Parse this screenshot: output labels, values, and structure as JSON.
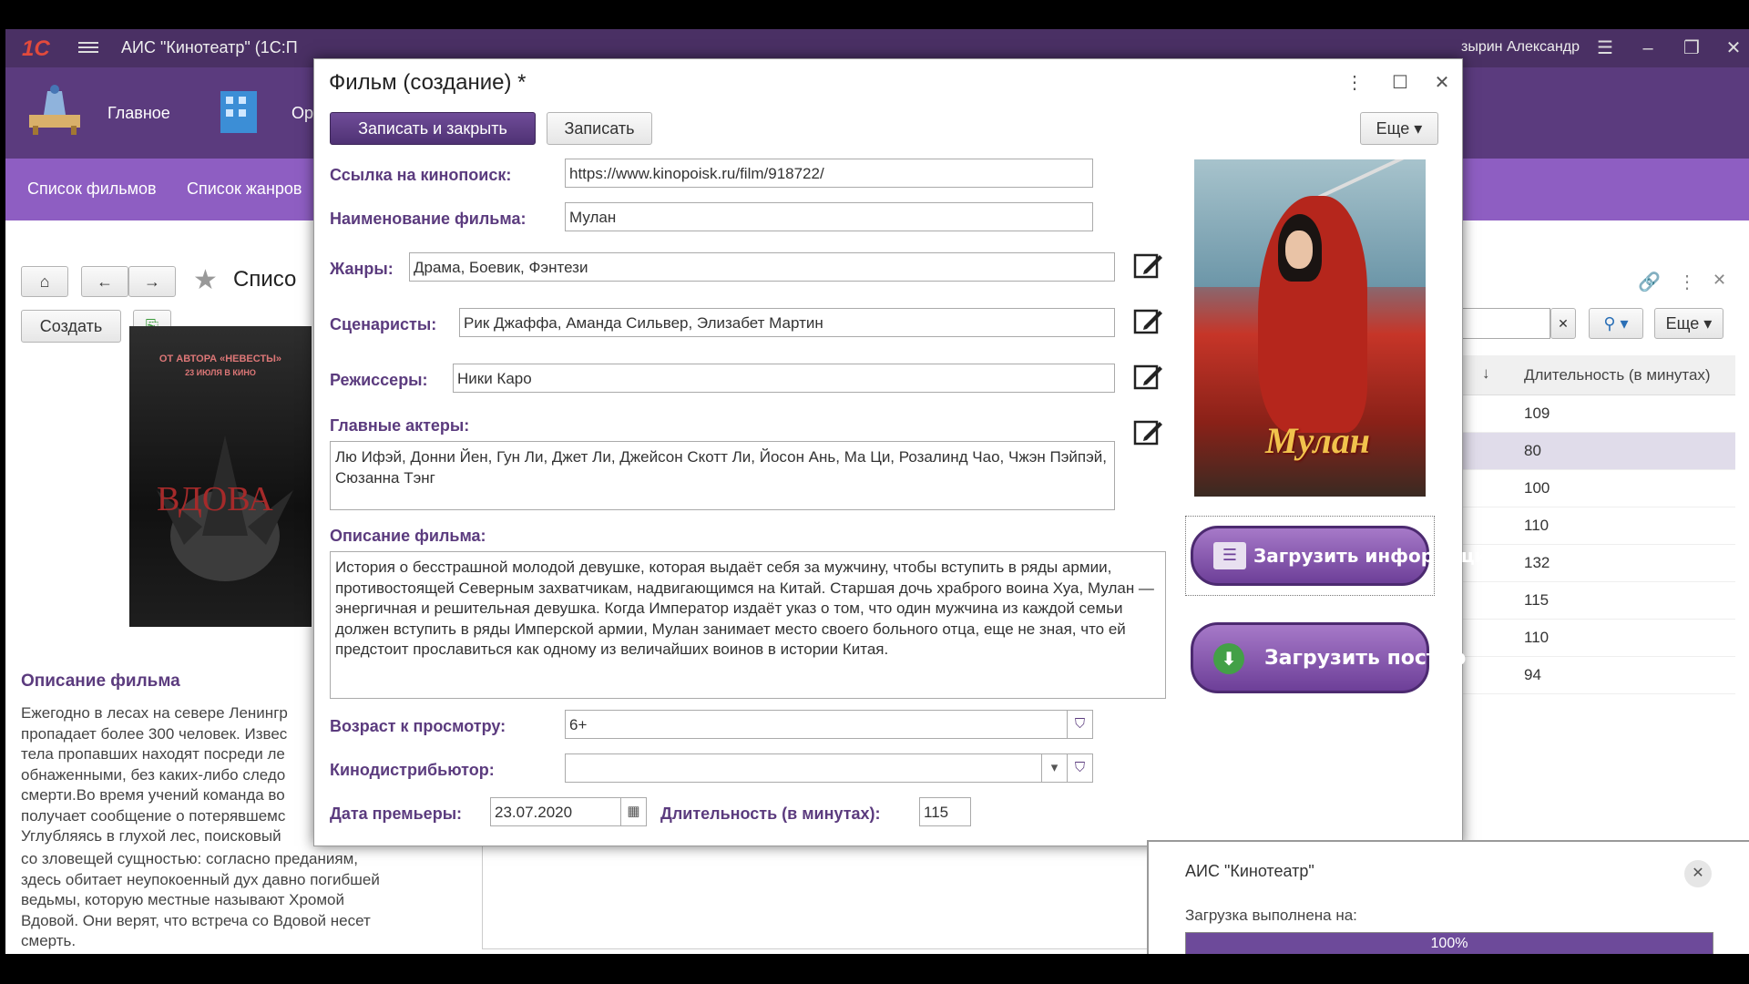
{
  "app": {
    "logo": "1С",
    "title": "АИС \"Кинотеатр\"  (1С:П",
    "user": "зырин Александр"
  },
  "sections": [
    {
      "label": "Главное"
    },
    {
      "label": "Ор"
    }
  ],
  "nav": {
    "films": "Список фильмов",
    "genres": "Список жанров"
  },
  "list": {
    "title": "Списо",
    "create_label": "Создать",
    "more_label": "Еще",
    "column_duration": "Длительность (в минутах)",
    "durations": [
      "109",
      "80",
      "100",
      "110",
      "132",
      "115",
      "110",
      "94"
    ],
    "selected_row": 1
  },
  "background_film": {
    "poster_top": "ОТ АВТОРА «НЕВЕСТЫ»",
    "poster_date": "23 ИЮЛЯ В КИНО",
    "poster_title": "ВДОВА",
    "desc_title": "Описание фильма",
    "desc_text": "Ежегодно в лесах на севере Ленингр пропадает более 300 человек. Извес тела пропавших находят посреди ле обнаженными, без каких-либо следо смерти.Во время учений команда во получает сообщение о потерявшемс Углубляясь в глухой лес, поисковый",
    "desc_text_lower": "со зловещей сущностью: согласно преданиям, здесь обитает неупокоенный дух давно погибшей ведьмы, которую местные называют Хромой Вдовой. Они верят, что встреча со Вдовой несет смерть."
  },
  "dialog": {
    "title": "Фильм (создание) *",
    "save_close_label": "Записать и закрыть",
    "save_label": "Записать",
    "more_label": "Еще",
    "fields": {
      "kinopoisk_label": "Ссылка на кинопоиск:",
      "kinopoisk_value": "https://www.kinopoisk.ru/film/918722/",
      "name_label": "Наименование фильма:",
      "name_value": "Мулан",
      "genres_label": "Жанры:",
      "genres_value": "Драма, Боевик, Фэнтези",
      "writers_label": "Сценаристы:",
      "writers_value": "Рик Джаффа, Аманда Сильвер, Элизабет Мартин",
      "directors_label": "Режиссеры:",
      "directors_value": "Ники Каро",
      "actors_label": "Главные актеры:",
      "actors_value": "Лю Ифэй, Донни Йен, Гун Ли, Джет Ли, Джейсон Скотт Ли, Йосон Ань, Ма Ци, Розалинд Чао, Чжэн Пэйпэй, Сюзанна Тэнг",
      "description_label": "Описание фильма:",
      "description_value": "История о бесстрашной молодой девушке, которая выдаёт себя за мужчину, чтобы вступить в ряды армии, противостоящей Северным захватчикам, надвигающимся на Китай. Старшая дочь храброго воина Хуа, Мулан — энергичная и решительная девушка. Когда Император издаёт указ о том, что один мужчина из каждой семьи должен вступить в ряды Имперской армии, Мулан занимает место своего больного отца, еще не зная, что ей предстоит прославиться как одному из величайших воинов в истории Китая.",
      "age_label": "Возраст к просмотру:",
      "age_value": "6+",
      "distributor_label": "Кинодистрибьютор:",
      "distributor_value": "",
      "premiere_label": "Дата премьеры:",
      "premiere_value": "23.07.2020",
      "duration_label": "Длительность (в минутах):",
      "duration_value": "115"
    },
    "poster_title": "Мулан",
    "load_info_label": "Загрузить информацию",
    "load_poster_label": "Загрузить постер"
  },
  "toast": {
    "title": "АИС \"Кинотеатр\"",
    "message": "Загрузка выполнена на:",
    "progress_text": "100%",
    "progress": 1.0
  },
  "colors": {
    "accent": "#5b3b7e",
    "nav": "#8e5ec2",
    "titlebar": "#4a3064"
  }
}
